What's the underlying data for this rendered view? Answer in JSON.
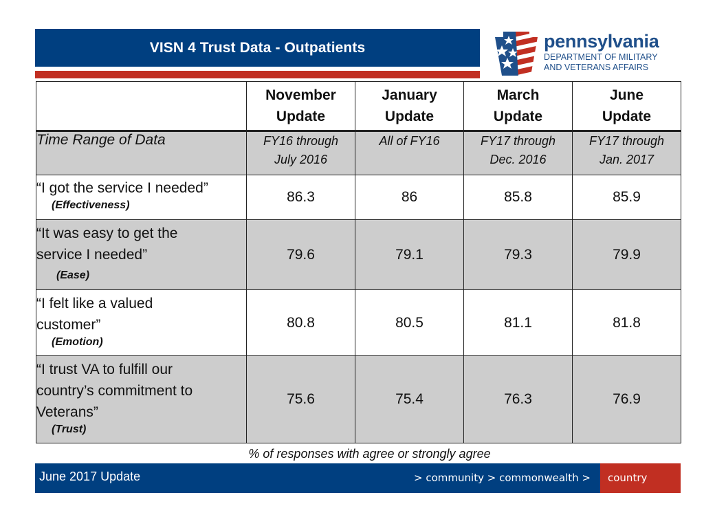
{
  "header": {
    "title": "VISN 4 Trust Data - Outpatients",
    "logo": {
      "name": "pennsylvania",
      "line1": "DEPARTMENT OF MILITARY",
      "line2": "AND VETERANS AFFAIRS",
      "icon": "keystone-flag-icon"
    }
  },
  "colors": {
    "navy": "#003f80",
    "red": "#c12f22",
    "gray": "#cdcdcd"
  },
  "table": {
    "columns": [
      {
        "line1": "November",
        "line2": "Update"
      },
      {
        "line1": "January",
        "line2": "Update"
      },
      {
        "line1": "March",
        "line2": "Update"
      },
      {
        "line1": "June",
        "line2": "Update"
      }
    ],
    "range_row": {
      "label": "Time Range of Data",
      "cells": [
        {
          "line1": "FY16 through",
          "line2": "July 2016"
        },
        {
          "line1": "All of FY16",
          "line2": ""
        },
        {
          "line1": "FY17 through",
          "line2": "Dec. 2016"
        },
        {
          "line1": "FY17 through",
          "line2": "Jan. 2017"
        }
      ]
    },
    "rows": [
      {
        "quote_lines": [
          "“I got the service I needed”"
        ],
        "category": "(Effectiveness)",
        "values": [
          "86.3",
          "86",
          "85.8",
          "85.9"
        ]
      },
      {
        "quote_lines": [
          "“It was easy to get the",
          "service I needed”"
        ],
        "category": "(Ease)",
        "values": [
          "79.6",
          "79.1",
          "79.3",
          "79.9"
        ]
      },
      {
        "quote_lines": [
          "“I felt like a valued",
          "customer”"
        ],
        "category": "(Emotion)",
        "values": [
          "80.8",
          "80.5",
          "81.1",
          "81.8"
        ]
      },
      {
        "quote_lines": [
          "“I trust VA to fulfill our",
          "country’s commitment to",
          "Veterans”"
        ],
        "category": "(Trust)",
        "values": [
          "75.6",
          "75.4",
          "76.3",
          "76.9"
        ]
      }
    ],
    "footnote": "% of responses with agree or strongly agree"
  },
  "footer": {
    "update": "June 2017 Update",
    "tagline": "> community > commonwealth >",
    "tagline_highlight": "country"
  }
}
